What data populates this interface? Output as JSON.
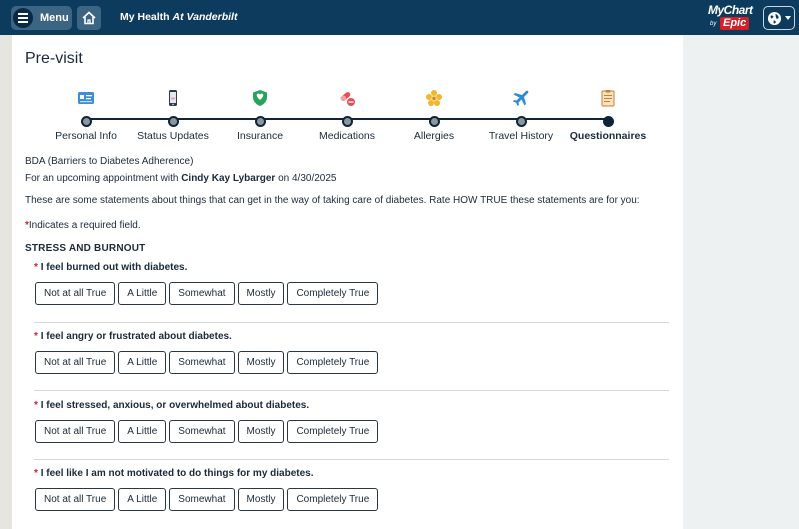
{
  "header": {
    "menu_label": "Menu",
    "app_title_main": "My Health ",
    "app_title_italic": "At Vanderbilt",
    "brand_name": "MyChart",
    "brand_by": "by",
    "brand_epic": "Epic"
  },
  "page": {
    "title": "Pre-visit"
  },
  "steps": [
    {
      "label": "Personal Info",
      "icon": "id-card-icon"
    },
    {
      "label": "Status Updates",
      "icon": "phone-icon"
    },
    {
      "label": "Insurance",
      "icon": "shield-icon"
    },
    {
      "label": "Medications",
      "icon": "pill-icon"
    },
    {
      "label": "Allergies",
      "icon": "flower-icon"
    },
    {
      "label": "Travel History",
      "icon": "airplane-icon"
    },
    {
      "label": "Questionnaires",
      "icon": "clipboard-icon",
      "active": true
    }
  ],
  "questionnaire": {
    "name": "BDA (Barriers to Diabetes Adherence)",
    "appt_prefix": "For an upcoming appointment with ",
    "provider": "Cindy Kay Lybarger",
    "appt_suffix": " on 4/30/2025",
    "instructions": "These are some statements about things that can get in the way of taking care of diabetes. Rate HOW TRUE these statements are for you:",
    "required_star": "*",
    "required_note": "Indicates a required field.",
    "section": "STRESS AND BURNOUT",
    "options": [
      "Not at all True",
      "A Little",
      "Somewhat",
      "Mostly",
      "Completely True"
    ],
    "questions": [
      "I feel burned out with diabetes.",
      "I feel angry or frustrated about diabetes.",
      "I feel stressed, anxious, or overwhelmed about diabetes.",
      "I feel like I am not motivated to do things for my diabetes."
    ]
  },
  "colors": {
    "header_bg": "#0c3b5e",
    "required": "#d21f2b",
    "epic_red": "#d21f2b"
  }
}
